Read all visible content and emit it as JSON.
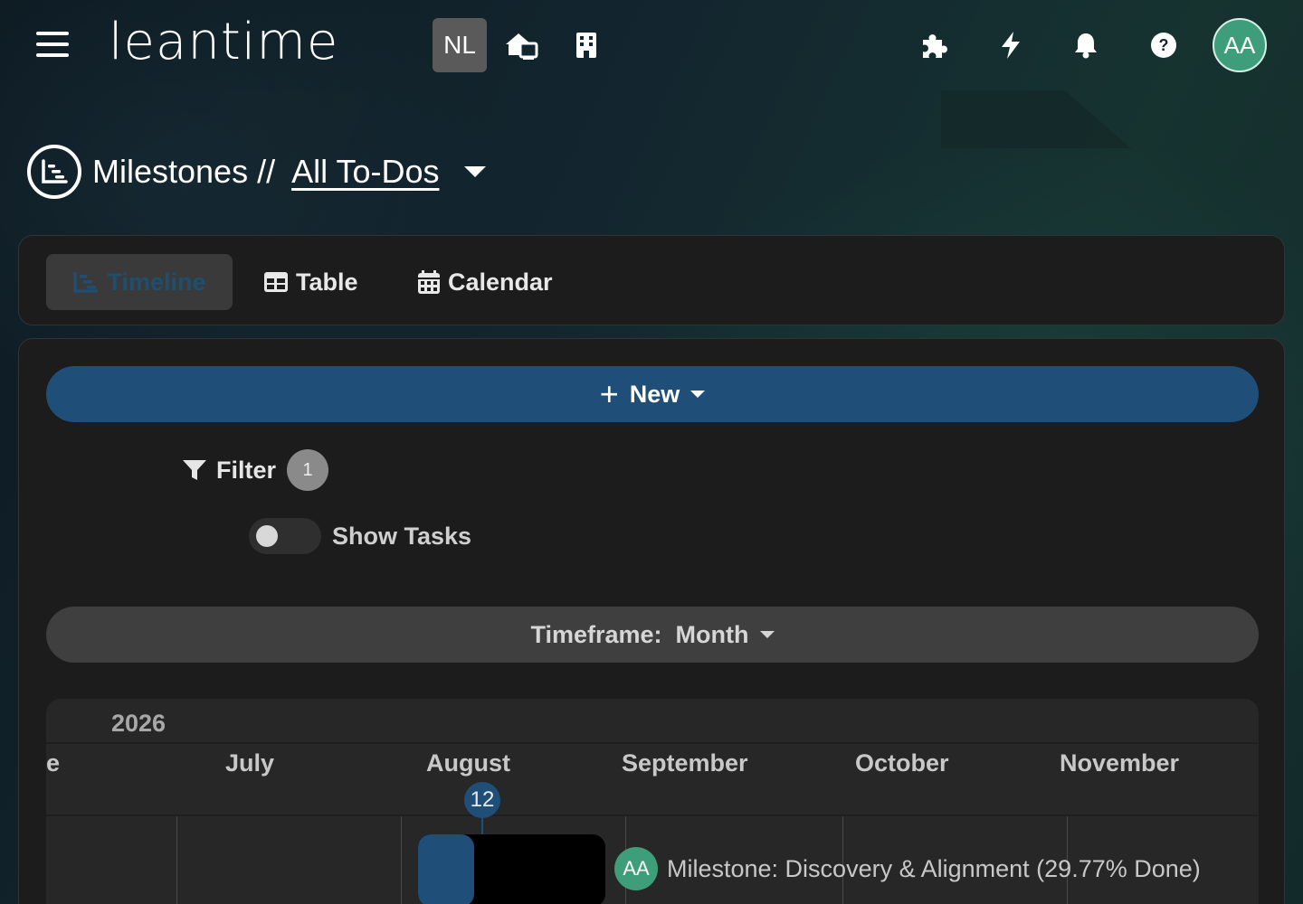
{
  "header": {
    "logo": "leantime",
    "workspace_initials": "NL",
    "user_initials": "AA",
    "icons": [
      "menu-icon",
      "home-switch-icon",
      "company-icon",
      "puzzle-icon",
      "bolt-icon",
      "bell-icon",
      "help-icon"
    ]
  },
  "page": {
    "title": "Milestones //",
    "filter_link": "All To-Dos"
  },
  "tabs": [
    {
      "label": "Timeline",
      "active": true
    },
    {
      "label": "Table",
      "active": false
    },
    {
      "label": "Calendar",
      "active": false
    }
  ],
  "toolbar": {
    "new_label": "New",
    "filter_label": "Filter",
    "filter_count": "1",
    "show_tasks_label": "Show Tasks",
    "show_tasks_on": false,
    "timeframe_label": "Timeframe:",
    "timeframe_value": "Month"
  },
  "gantt": {
    "year": "2026",
    "months": [
      "e",
      "July",
      "August",
      "September",
      "October",
      "November"
    ],
    "today_day": "12",
    "milestone": {
      "owner_initials": "AA",
      "label": "Milestone: Discovery & Alignment (29.77% Done)",
      "progress": 0.2977
    }
  },
  "colors": {
    "primary": "#1f4e79",
    "avatar": "#3e9e7c",
    "panel": "#1c1c1c"
  }
}
